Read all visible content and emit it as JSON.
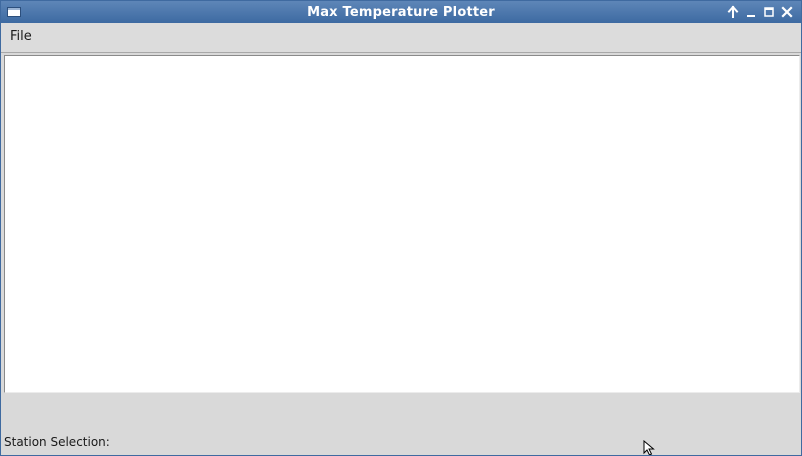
{
  "window": {
    "title": "Max Temperature Plotter",
    "controls": {
      "shade_icon": "arrow-up-icon",
      "minimize_icon": "minimize-icon",
      "maximize_icon": "maximize-icon",
      "close_icon": "close-icon"
    }
  },
  "menubar": {
    "items": [
      {
        "label": "File"
      }
    ]
  },
  "footer": {
    "station_label": "Station Selection:"
  },
  "colors": {
    "titlebar": "#3d6aa2",
    "background": "#d9d9d9",
    "plot_background": "#ffffff"
  }
}
